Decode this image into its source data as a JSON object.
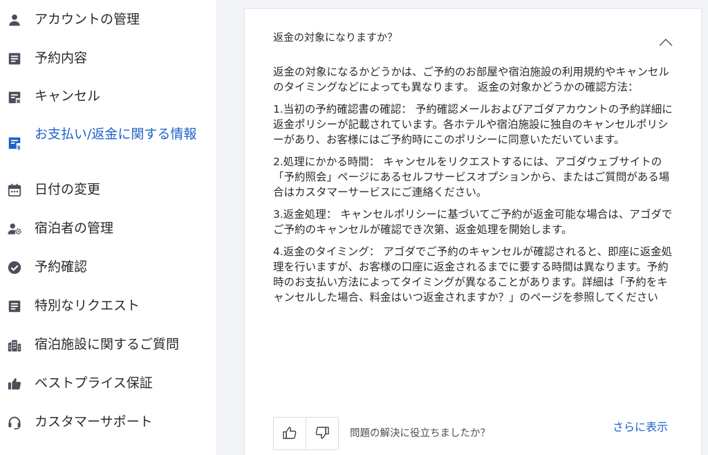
{
  "sidebar": {
    "items": [
      {
        "label": "アカウントの管理",
        "icon": "person-icon"
      },
      {
        "label": "予約内容",
        "icon": "document-icon"
      },
      {
        "label": "キャンセル",
        "icon": "cancel-document-icon"
      },
      {
        "label": "お支払い/返金に関する情報",
        "icon": "payment-document-icon",
        "active": true
      },
      {
        "label": "日付の変更",
        "icon": "calendar-icon"
      },
      {
        "label": "宿泊者の管理",
        "icon": "guest-settings-icon"
      },
      {
        "label": "予約確認",
        "icon": "check-circle-icon"
      },
      {
        "label": "特別なリクエスト",
        "icon": "document-icon"
      },
      {
        "label": "宿泊施設に関するご質問",
        "icon": "building-icon"
      },
      {
        "label": "ベストプライス保証",
        "icon": "thumbs-up-icon"
      },
      {
        "label": "カスタマーサポート",
        "icon": "headset-icon"
      }
    ]
  },
  "faq": {
    "question": "返金の対象になりますか？",
    "paragraphs": [
      "返金の対象になるかどうかは、ご予約のお部屋や宿泊施設の利用規約やキャンセルのタイミングなどによっても異なります。 返金の対象かどうかの確認方法：",
      "1.当初の予約確認書の確認： 予約確認メールおよびアゴダアカウントの予約詳細に返金ポリシーが記載されています。各ホテルや宿泊施設に独自のキャンセルポリシーがあり、お客様にはご予約時にこのポリシーに同意いただいています。",
      "2.処理にかかる時間： キャンセルをリクエストするには、アゴダウェブサイトの「予約照会」ページにあるセルフサービスオプションから、またはご質問がある場合はカスタマーサービスにご連絡ください。",
      "3.返金処理： キャンセルポリシーに基づいてご予約が返金可能な場合は、アゴダでご予約のキャンセルが確認でき次第、返金処理を開始します。",
      "4.返金のタイミング： アゴダでご予約のキャンセルが確認されると、即座に返金処理を行いますが、お客様の口座に返金されるまでに要する時間は異なります。予約時のお支払い方法によってタイミングが異なることがあります。詳細は「予約をキャンセルした場合、料金はいつ返金されますか？」のページを参照してください"
    ],
    "helpful_prompt": "問題の解決に役立ちましたか？",
    "show_more": "さらに表示"
  },
  "colors": {
    "accent": "#1e62c8",
    "icon": "#4a4f5a",
    "background": "#f2f4f7"
  }
}
